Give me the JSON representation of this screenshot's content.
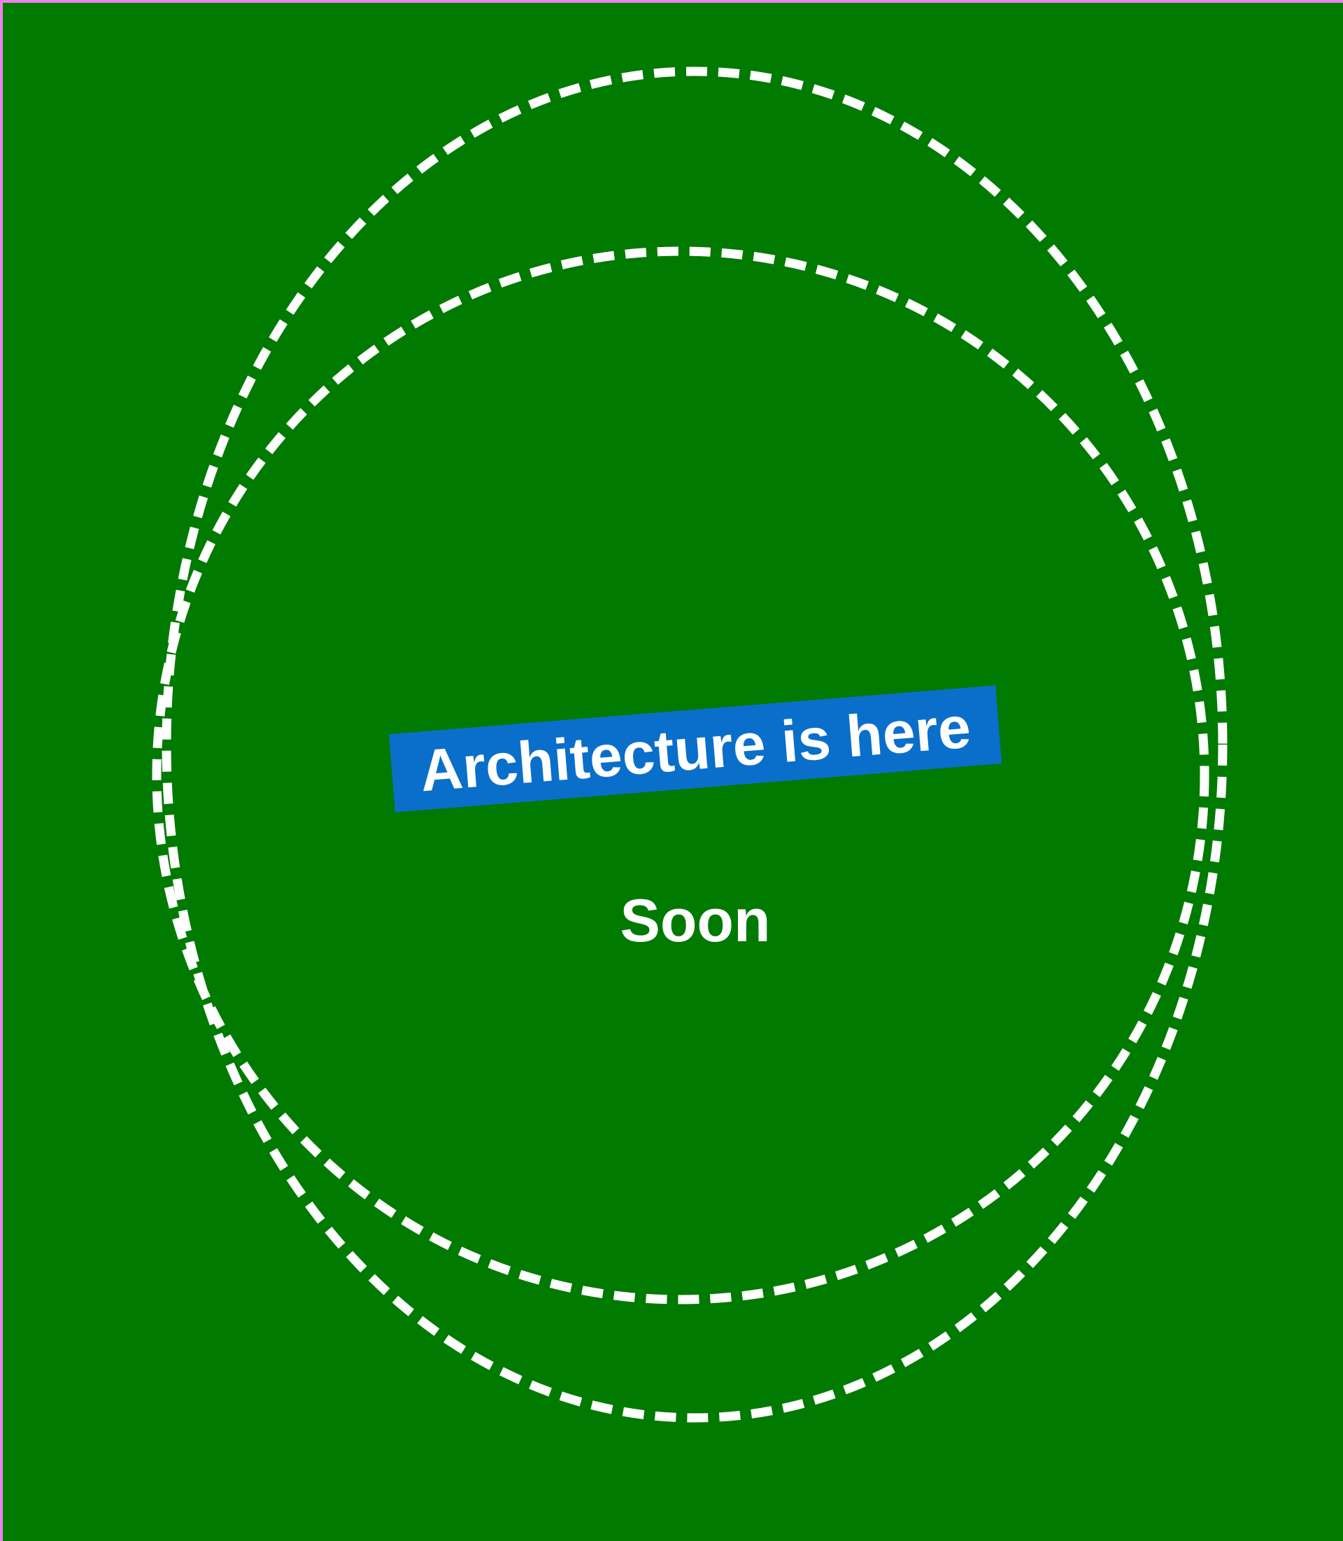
{
  "colors": {
    "page_border": "#ee82ee",
    "background": "#007a00",
    "ring_stroke": "#ffffff",
    "headline_highlight": "#0a6fca",
    "text": "#ffffff"
  },
  "headline": "Architecture is here",
  "subline": "Soon"
}
